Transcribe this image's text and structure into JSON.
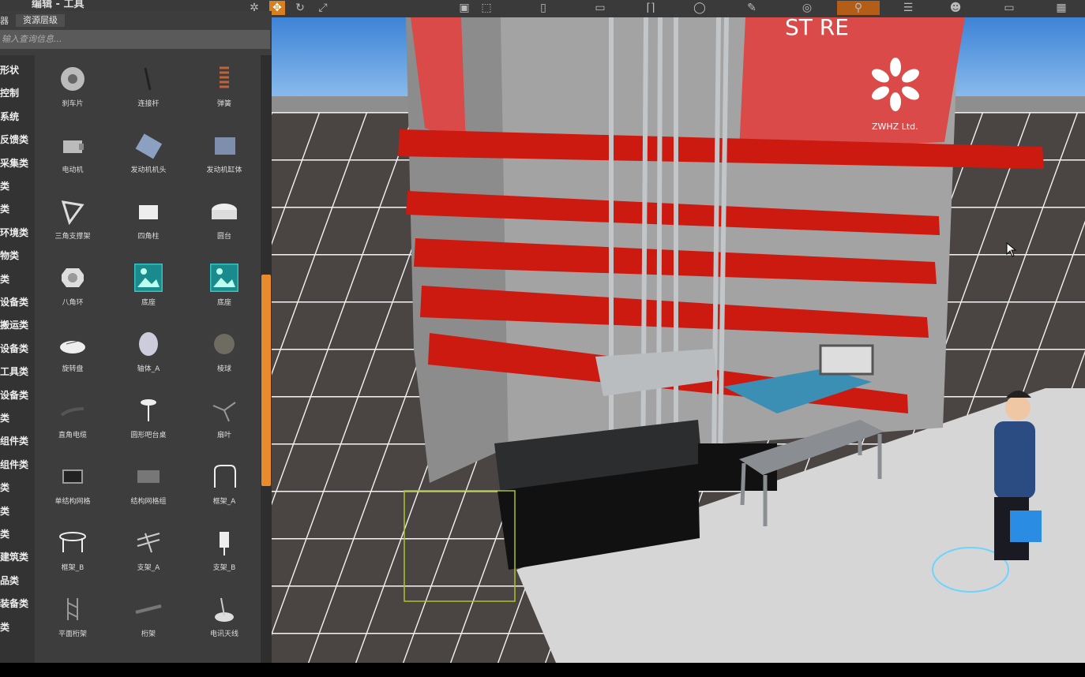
{
  "window": {
    "title": "编辑 - 工具"
  },
  "toolbar": {
    "tools": [
      {
        "name": "move-tool",
        "icon": "✥",
        "active": true
      },
      {
        "name": "rotate-tool",
        "icon": "↻",
        "active": false
      },
      {
        "name": "scale-tool",
        "icon": "⤢",
        "active": false
      }
    ]
  },
  "panel": {
    "tab_label": "资源层级",
    "tab_prefix": "器",
    "search_placeholder": "输入查询信息..."
  },
  "categories": [
    "形状",
    "控制",
    "系统",
    "反馈类",
    "采集类",
    "类",
    "类",
    "环境类",
    "物类",
    "类",
    "设备类",
    "搬运类",
    "设备类",
    "工具类",
    "设备类",
    "类",
    "组件类",
    "组件类",
    "类",
    "类",
    "类",
    "建筑类",
    "品类",
    "装备类",
    "类"
  ],
  "assets": [
    {
      "label": "刹车片",
      "icon": "disc-icon"
    },
    {
      "label": "连接杆",
      "icon": "rod-icon"
    },
    {
      "label": "弹簧",
      "icon": "spring-icon"
    },
    {
      "label": "电动机",
      "icon": "motor-icon"
    },
    {
      "label": "发动机机头",
      "icon": "engine-head-icon"
    },
    {
      "label": "发动机缸体",
      "icon": "engine-block-icon"
    },
    {
      "label": "三角支撑架",
      "icon": "triangle-frame-icon"
    },
    {
      "label": "四角柱",
      "icon": "square-pillar-icon"
    },
    {
      "label": "圆台",
      "icon": "round-table-icon"
    },
    {
      "label": "八角环",
      "icon": "octagon-ring-icon"
    },
    {
      "label": "底座",
      "icon": "image-placeholder-icon"
    },
    {
      "label": "底座",
      "icon": "image-placeholder-icon"
    },
    {
      "label": "旋转盘",
      "icon": "rotating-plate-icon"
    },
    {
      "label": "轴体_A",
      "icon": "shaft-icon"
    },
    {
      "label": "棱球",
      "icon": "sphere-icon"
    },
    {
      "label": "直角电缆",
      "icon": "cable-icon"
    },
    {
      "label": "圆形吧台桌",
      "icon": "bar-table-icon"
    },
    {
      "label": "扇叶",
      "icon": "fan-blade-icon"
    },
    {
      "label": "单结构网格",
      "icon": "single-grid-icon"
    },
    {
      "label": "结构网格组",
      "icon": "grid-group-icon"
    },
    {
      "label": "框架_A",
      "icon": "frame-a-icon"
    },
    {
      "label": "框架_B",
      "icon": "frame-b-icon"
    },
    {
      "label": "支架_A",
      "icon": "bracket-a-icon"
    },
    {
      "label": "支架_B",
      "icon": "bracket-b-icon"
    },
    {
      "label": "平面桁架",
      "icon": "plane-truss-icon"
    },
    {
      "label": "桁架",
      "icon": "truss-icon"
    },
    {
      "label": "电讯天线",
      "icon": "antenna-icon"
    }
  ],
  "scene": {
    "store_sign_text": "ST  RE",
    "logo_text": "ZWHZ Ltd.",
    "colors": {
      "accent": "#e98b2a",
      "sign_red": "#d94a48",
      "rail_red": "#cc1a10",
      "sky_top": "#3e83d6",
      "floor": "#494443"
    }
  }
}
